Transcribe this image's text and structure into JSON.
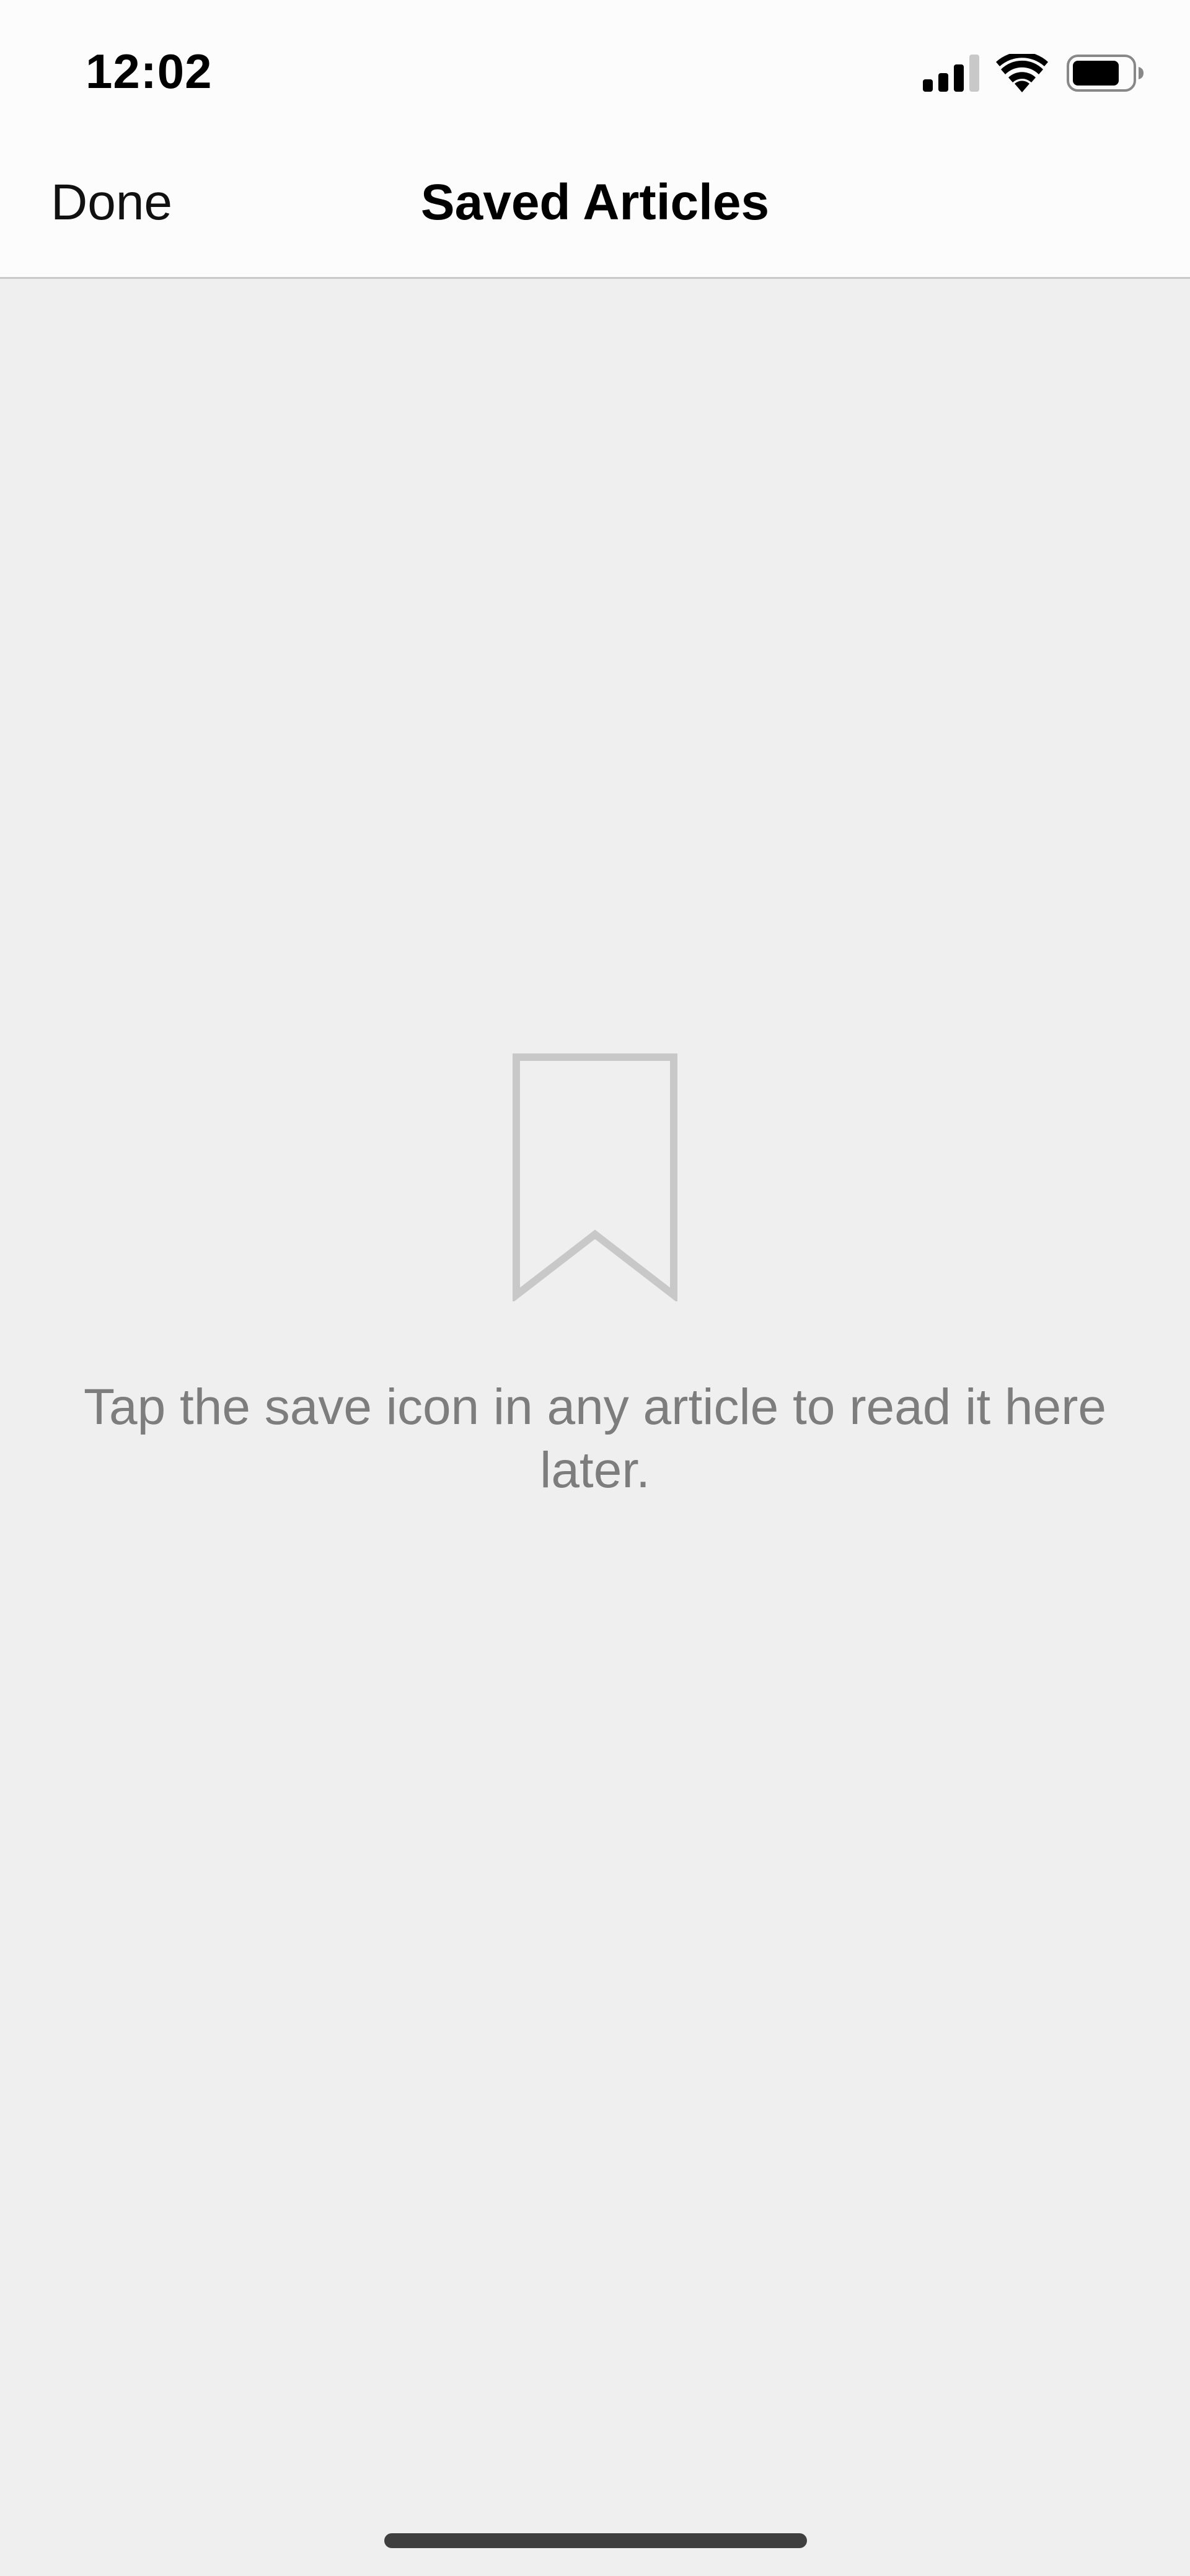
{
  "status_bar": {
    "time": "12:02",
    "icons": [
      "cellular-signal-icon",
      "wifi-icon",
      "battery-icon"
    ]
  },
  "nav": {
    "done_label": "Done",
    "title": "Saved Articles"
  },
  "empty_state": {
    "icon": "bookmark-icon",
    "message": "Tap the save icon in any article to read it here later."
  },
  "colors": {
    "background": "#efefef",
    "bar_background": "#fcfcfc",
    "icon_gray": "#c8c8c8",
    "message_text": "#7d7d7d",
    "home_indicator": "#3f3f3f"
  }
}
